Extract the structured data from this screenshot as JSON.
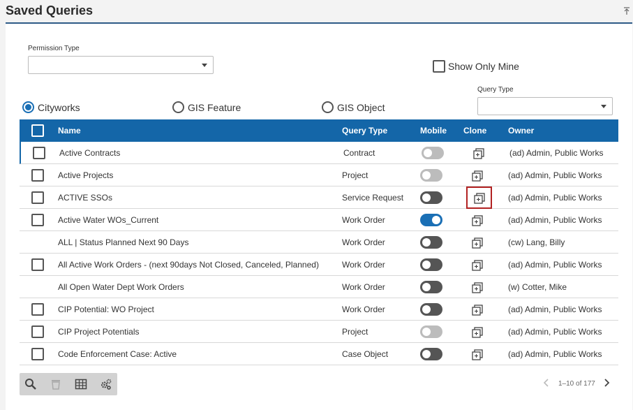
{
  "header": {
    "title": "Saved Queries"
  },
  "filters": {
    "permission_type_label": "Permission Type",
    "permission_type_value": "",
    "show_only_mine_label": "Show Only Mine",
    "query_type_label": "Query Type",
    "query_type_value": ""
  },
  "radios": [
    {
      "label": "Cityworks",
      "selected": true
    },
    {
      "label": "GIS Feature",
      "selected": false
    },
    {
      "label": "GIS Object",
      "selected": false
    }
  ],
  "table": {
    "headers": {
      "name": "Name",
      "query_type": "Query Type",
      "mobile": "Mobile",
      "clone": "Clone",
      "owner": "Owner"
    },
    "rows": [
      {
        "name": "Active Contracts",
        "query_type": "Contract",
        "mobile": "disabled",
        "owner": "(ad) Admin, Public Works",
        "checkbox": true
      },
      {
        "name": "Active Projects",
        "query_type": "Project",
        "mobile": "disabled",
        "owner": "(ad) Admin, Public Works",
        "checkbox": true
      },
      {
        "name": "ACTIVE SSOs",
        "query_type": "Service Request",
        "mobile": "off",
        "owner": "(ad) Admin, Public Works",
        "checkbox": true
      },
      {
        "name": "Active Water WOs_Current",
        "query_type": "Work Order",
        "mobile": "on",
        "owner": "(ad) Admin, Public Works",
        "checkbox": true
      },
      {
        "name": "ALL | Status Planned Next 90 Days",
        "query_type": "Work Order",
        "mobile": "off",
        "owner": "(cw) Lang, Billy",
        "checkbox": false
      },
      {
        "name": "All Active Work Orders - (next 90days Not Closed, Canceled, Planned)",
        "query_type": "Work Order",
        "mobile": "off",
        "owner": "(ad) Admin, Public Works",
        "checkbox": true
      },
      {
        "name": "All Open Water Dept Work Orders",
        "query_type": "Work Order",
        "mobile": "off",
        "owner": "(w) Cotter, Mike",
        "checkbox": false
      },
      {
        "name": "CIP Potential: WO Project",
        "query_type": "Work Order",
        "mobile": "off",
        "owner": "(ad) Admin, Public Works",
        "checkbox": true
      },
      {
        "name": "CIP Project Potentials",
        "query_type": "Project",
        "mobile": "disabled",
        "owner": "(ad) Admin, Public Works",
        "checkbox": true
      },
      {
        "name": "Code Enforcement Case: Active",
        "query_type": "Case Object",
        "mobile": "off",
        "owner": "(ad) Admin, Public Works",
        "checkbox": true
      }
    ]
  },
  "toolbar": {
    "icons": [
      "search-icon",
      "trash-icon",
      "grid-icon",
      "settings-icon"
    ]
  },
  "pager": {
    "text": "1–10 of 177"
  },
  "colors": {
    "accent": "#1466a8",
    "toggle_on": "#1a6fb5",
    "highlight": "#b22222"
  }
}
